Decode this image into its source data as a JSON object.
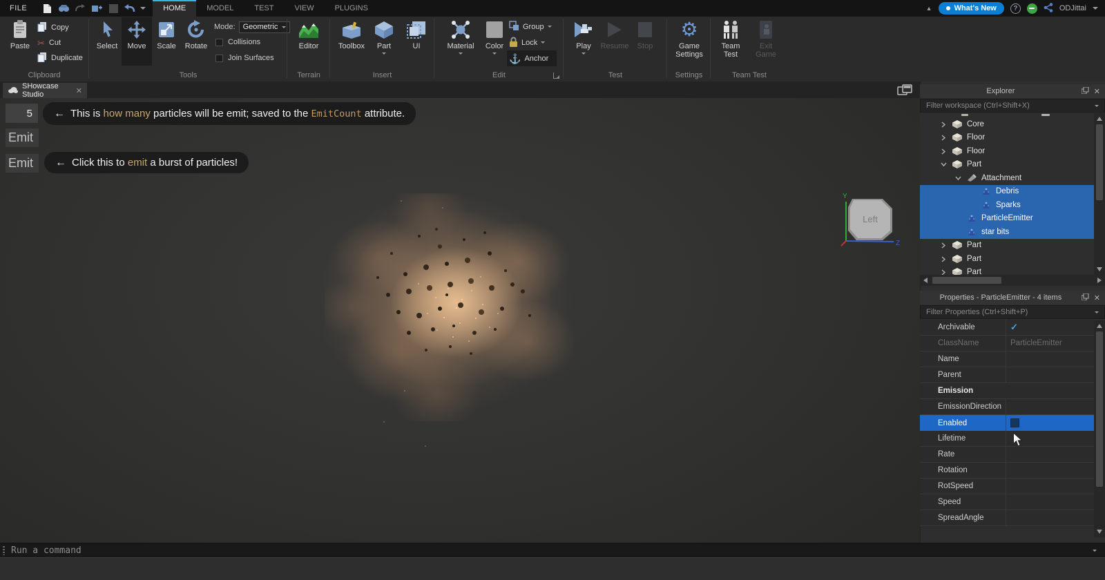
{
  "titlebar": {
    "file_menu": "FILE",
    "tabs": [
      "HOME",
      "MODEL",
      "TEST",
      "VIEW",
      "PLUGINS"
    ],
    "whats_new": "What's New",
    "username": "ODJittai"
  },
  "ribbon": {
    "clipboard": {
      "group": "Clipboard",
      "paste": "Paste",
      "copy": "Copy",
      "cut": "Cut",
      "duplicate": "Duplicate"
    },
    "tools": {
      "group": "Tools",
      "select": "Select",
      "move": "Move",
      "scale": "Scale",
      "rotate": "Rotate",
      "mode_label": "Mode:",
      "mode_value": "Geometric",
      "collisions": "Collisions",
      "join_surfaces": "Join Surfaces"
    },
    "terrain": {
      "group": "Terrain",
      "editor": "Editor"
    },
    "insert": {
      "group": "Insert",
      "toolbox": "Toolbox",
      "part": "Part",
      "ui": "UI"
    },
    "edit": {
      "group": "Edit",
      "material": "Material",
      "color": "Color",
      "group_btn": "Group",
      "lock": "Lock",
      "anchor": "Anchor"
    },
    "test": {
      "group": "Test",
      "play": "Play",
      "resume": "Resume",
      "stop": "Stop"
    },
    "settings": {
      "group": "Settings",
      "game_settings": "Game Settings"
    },
    "team_test": {
      "group": "Team Test",
      "team_test": "Team Test",
      "exit_game": "Exit Game"
    }
  },
  "doc_tab": {
    "title": "SHowcase Studio"
  },
  "viewport": {
    "emit_count_value": "5",
    "emit_button_1": "Emit",
    "emit_button_2": "Emit",
    "annotation_emit_count": {
      "arrow": "←",
      "t1": "This is ",
      "hl1": "how many",
      "t2": " particles will be emit; saved to the ",
      "code": "EmitCount",
      "t3": " attribute."
    },
    "annotation_click": {
      "arrow": "←",
      "t1": "Click this to ",
      "hl1": "emit",
      "t2": " a burst of particles!"
    },
    "view_cube": {
      "face": "Left",
      "axis_y": "Y",
      "axis_z": "Z"
    }
  },
  "explorer": {
    "title": "Explorer",
    "filter_placeholder": "Filter workspace (Ctrl+Shift+X)",
    "tree": [
      {
        "label": "Core"
      },
      {
        "label": "Floor"
      },
      {
        "label": "Floor"
      },
      {
        "label": "Part"
      },
      {
        "label": "Attachment"
      },
      {
        "label": "Debris"
      },
      {
        "label": "Sparks"
      },
      {
        "label": "ParticleEmitter"
      },
      {
        "label": "star bits"
      },
      {
        "label": "Part"
      },
      {
        "label": "Part"
      },
      {
        "label": "Part"
      }
    ]
  },
  "properties": {
    "title": "Properties - ParticleEmitter - 4 items",
    "filter_placeholder": "Filter Properties (Ctrl+Shift+P)",
    "rows": [
      {
        "name": "Archivable",
        "value": ""
      },
      {
        "name": "ClassName",
        "value": "ParticleEmitter"
      },
      {
        "name": "Name",
        "value": ""
      },
      {
        "name": "Parent",
        "value": ""
      },
      {
        "name": "Emission",
        "value": ""
      },
      {
        "name": "EmissionDirection",
        "value": ""
      },
      {
        "name": "Enabled",
        "value": ""
      },
      {
        "name": "Lifetime",
        "value": ""
      },
      {
        "name": "Rate",
        "value": ""
      },
      {
        "name": "Rotation",
        "value": ""
      },
      {
        "name": "RotSpeed",
        "value": ""
      },
      {
        "name": "Speed",
        "value": ""
      },
      {
        "name": "SpreadAngle",
        "value": ""
      }
    ]
  },
  "command_bar": {
    "placeholder": "Run a command"
  },
  "colors": {
    "selection_blue": "#2a66b0",
    "enabled_row_blue": "#1f67c5",
    "accent_cyan": "#35b5e5",
    "whats_new_blue": "#0a7fd4",
    "check_blue": "#4ba3e3",
    "particle_glow": "#f2c898"
  }
}
